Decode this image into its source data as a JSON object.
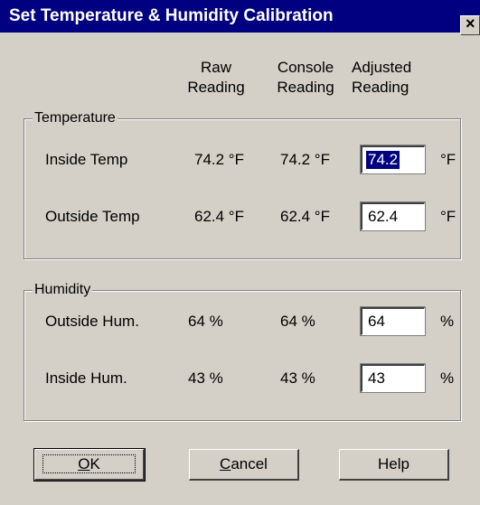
{
  "window": {
    "title": "Set Temperature & Humidity Calibration",
    "close_glyph": "×"
  },
  "columns": {
    "raw": [
      "Raw",
      "Reading"
    ],
    "console": [
      "Console",
      "Reading"
    ],
    "adjusted": [
      "Adjusted",
      "Reading"
    ]
  },
  "temperature": {
    "legend": "Temperature",
    "rows": [
      {
        "label": "Inside Temp",
        "raw": "74.2 °F",
        "console": "74.2 °F",
        "adjusted": "74.2",
        "unit": "°F",
        "selected": true
      },
      {
        "label": "Outside Temp",
        "raw": "62.4 °F",
        "console": "62.4 °F",
        "adjusted": "62.4",
        "unit": "°F",
        "selected": false
      }
    ]
  },
  "humidity": {
    "legend": "Humidity",
    "rows": [
      {
        "label": "Outside Hum.",
        "raw": "64 %",
        "console": "64 %",
        "adjusted": "64",
        "unit": "%"
      },
      {
        "label": "Inside Hum.",
        "raw": "43 %",
        "console": "43 %",
        "adjusted": "43",
        "unit": "%"
      }
    ]
  },
  "buttons": {
    "ok_mnemonic": "O",
    "ok_rest": "K",
    "cancel_mnemonic": "C",
    "cancel_rest": "ancel",
    "help": "Help"
  },
  "colors": {
    "titlebar": "#000080",
    "face": "#d4d0c8",
    "selection": "#000080"
  }
}
